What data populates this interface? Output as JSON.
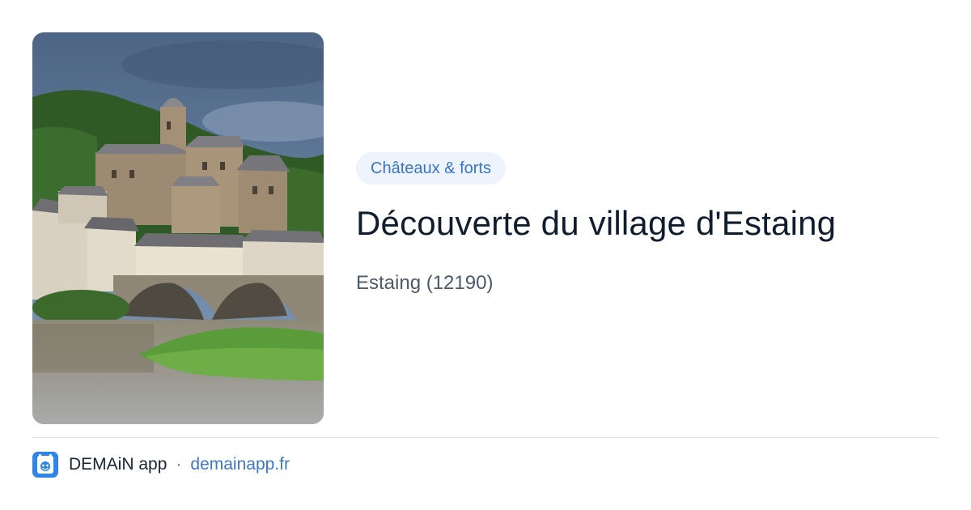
{
  "card": {
    "image_alt": "Château d'Estaing et pont sur le Lot",
    "category": "Châteaux & forts",
    "title": "Découverte du village d'Estaing",
    "location": "Estaing (12190)"
  },
  "footer": {
    "app_name": "DEMAiN app",
    "separator": "·",
    "domain": "demainapp.fr",
    "logo_icon": "demain-logo-icon"
  },
  "colors": {
    "chip_bg": "#eef4fd",
    "chip_text": "#3b74c4",
    "title": "#0f1d2e",
    "link": "#3b78c9",
    "logo_bg": "#2f86e8"
  }
}
